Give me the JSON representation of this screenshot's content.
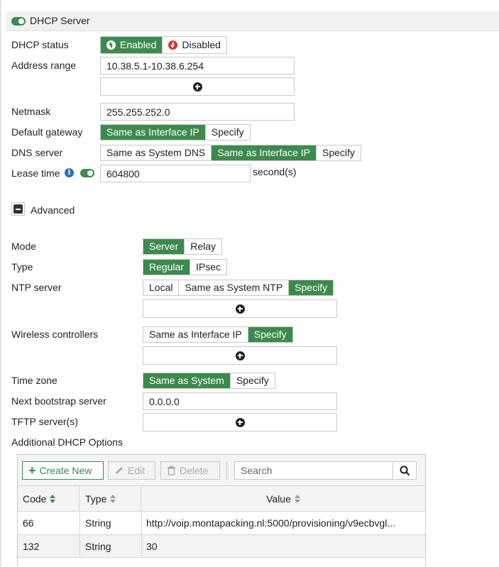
{
  "dhcp": {
    "header": "DHCP Server",
    "status_label": "DHCP status",
    "status_enabled": "Enabled",
    "status_disabled": "Disabled",
    "address_range_label": "Address range",
    "address_range_value": "10.38.5.1-10.38.6.254",
    "netmask_label": "Netmask",
    "netmask_value": "255.255.252.0",
    "gateway_label": "Default gateway",
    "gateway_options": [
      "Same as Interface IP",
      "Specify"
    ],
    "dns_label": "DNS server",
    "dns_options": [
      "Same as System DNS",
      "Same as Interface IP",
      "Specify"
    ],
    "lease_label": "Lease time",
    "lease_value": "604800",
    "lease_unit": "second(s)",
    "advanced_label": "Advanced"
  },
  "advanced": {
    "mode_label": "Mode",
    "mode_options": [
      "Server",
      "Relay"
    ],
    "type_label": "Type",
    "type_options": [
      "Regular",
      "IPsec"
    ],
    "ntp_label": "NTP server",
    "ntp_options": [
      "Local",
      "Same as System NTP",
      "Specify"
    ],
    "wireless_label": "Wireless controllers",
    "wireless_options": [
      "Same as Interface IP",
      "Specify"
    ],
    "timezone_label": "Time zone",
    "timezone_options": [
      "Same as System",
      "Specify"
    ],
    "bootstrap_label": "Next bootstrap server",
    "bootstrap_value": "0.0.0.0",
    "tftp_label": "TFTP server(s)",
    "additional_label": "Additional DHCP Options"
  },
  "table": {
    "create_new": "Create New",
    "edit": "Edit",
    "delete": "Delete",
    "search_placeholder": "Search",
    "columns": [
      "Code",
      "Type",
      "Value"
    ],
    "rows": [
      {
        "code": "66",
        "type": "String",
        "value": "http://voip.montapacking.nl:5000/provisioning/v9ecbvgl..."
      },
      {
        "code": "132",
        "type": "String",
        "value": "30"
      }
    ]
  },
  "colors": {
    "accent": "#3c8a4d",
    "disabled_red": "#d9322b",
    "info_blue": "#2a6fb5"
  }
}
